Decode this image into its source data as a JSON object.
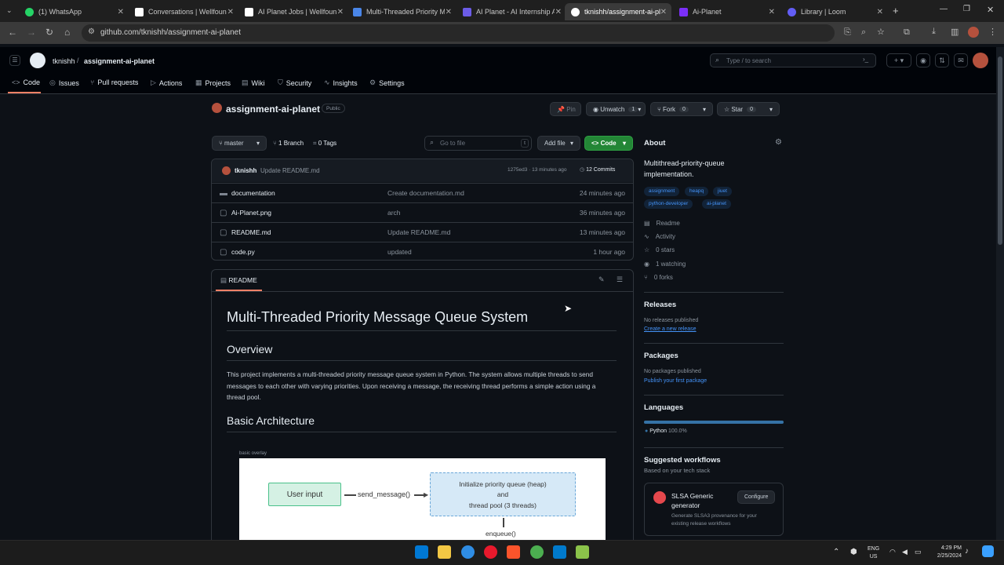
{
  "browser": {
    "tabs": [
      {
        "title": "(1) WhatsApp",
        "icon_color": "#25d366"
      },
      {
        "title": "Conversations | Wellfound",
        "icon_color": "#ffffff"
      },
      {
        "title": "AI Planet Jobs | Wellfound",
        "icon_color": "#ffffff"
      },
      {
        "title": "Multi-Threaded Priority M",
        "icon_color": "#4a86e8"
      },
      {
        "title": "AI Planet - AI Internship A",
        "icon_color": "#6c5ce7"
      },
      {
        "title": "tknishh/assignment-ai-pl",
        "icon_color": "#ffffff"
      },
      {
        "title": "Ai-Planet",
        "icon_color": "#7b2ff7"
      },
      {
        "title": "Library | Loom",
        "icon_color": "#625df5"
      }
    ],
    "url": "github.com/tknishh/assignment-ai-planet"
  },
  "header": {
    "owner": "tknishh",
    "repo": "assignment-ai-planet",
    "search_placeholder": "Type / to search",
    "nav": [
      "Code",
      "Issues",
      "Pull requests",
      "Actions",
      "Projects",
      "Wiki",
      "Security",
      "Insights",
      "Settings"
    ]
  },
  "repo": {
    "name": "assignment-ai-planet",
    "visibility": "Public",
    "pin": "Pin",
    "unwatch": "Unwatch",
    "unwatch_count": "1",
    "fork": "Fork",
    "fork_count": "0",
    "star": "Star",
    "star_count": "0",
    "branch": "master",
    "branches": "1 Branch",
    "tags": "0 Tags",
    "go_to_file": "Go to file",
    "go_to_file_key": "t",
    "add_file": "Add file",
    "code": "Code"
  },
  "commit": {
    "author": "tknishh",
    "message": "Update README.md",
    "hash_time": "1275ed3 · 13 minutes ago",
    "commits": "12 Commits"
  },
  "files": [
    {
      "name": "documentation",
      "type": "dir",
      "msg": "Create documentation.md",
      "date": "24 minutes ago"
    },
    {
      "name": "Ai-Planet.png",
      "type": "file",
      "msg": "arch",
      "date": "36 minutes ago"
    },
    {
      "name": "README.md",
      "type": "file",
      "msg": "Update README.md",
      "date": "13 minutes ago"
    },
    {
      "name": "code.py",
      "type": "file",
      "msg": "updated",
      "date": "1 hour ago"
    }
  ],
  "readme": {
    "tab": "README",
    "h1": "Multi-Threaded Priority Message Queue System",
    "h2_overview": "Overview",
    "overview": "This project implements a multi-threaded priority message queue system in Python. The system allows multiple threads to send messages to each other with varying priorities. Upon receiving a message, the receiving thread performs a simple action using a thread pool.",
    "h2_arch": "Basic Architecture",
    "diagram_caption": "basic overlay",
    "diagram": {
      "user_input": "User input",
      "send": "send_message()",
      "init_1": "Initialize priority queue (heap)",
      "init_2": "and",
      "init_3": "thread pool (3 threads)",
      "enqueue": "enqueue()"
    }
  },
  "about": {
    "title": "About",
    "desc": "Multithread-priority-queue implementation.",
    "topics": [
      "assignment",
      "heapq",
      "jiuet",
      "python-developer",
      "ai-planet"
    ],
    "readme": "Readme",
    "activity": "Activity",
    "stars": "0 stars",
    "watching": "1 watching",
    "forks": "0 forks"
  },
  "releases": {
    "title": "Releases",
    "none": "No releases published",
    "link": "Create a new release"
  },
  "packages": {
    "title": "Packages",
    "none": "No packages published",
    "link": "Publish your first package"
  },
  "languages": {
    "title": "Languages",
    "name": "Python",
    "pct": "100.0%",
    "share": 1.0,
    "color": "#3572A5"
  },
  "workflows": {
    "title": "Suggested workflows",
    "sub": "Based on your tech stack",
    "name": "SLSA Generic generator",
    "desc": "Generate SLSA3 provenance for your existing release workflows",
    "configure": "Configure"
  },
  "taskbar": {
    "lang1": "ENG",
    "lang2": "US",
    "time": "4:29 PM",
    "date": "2/25/2024"
  }
}
